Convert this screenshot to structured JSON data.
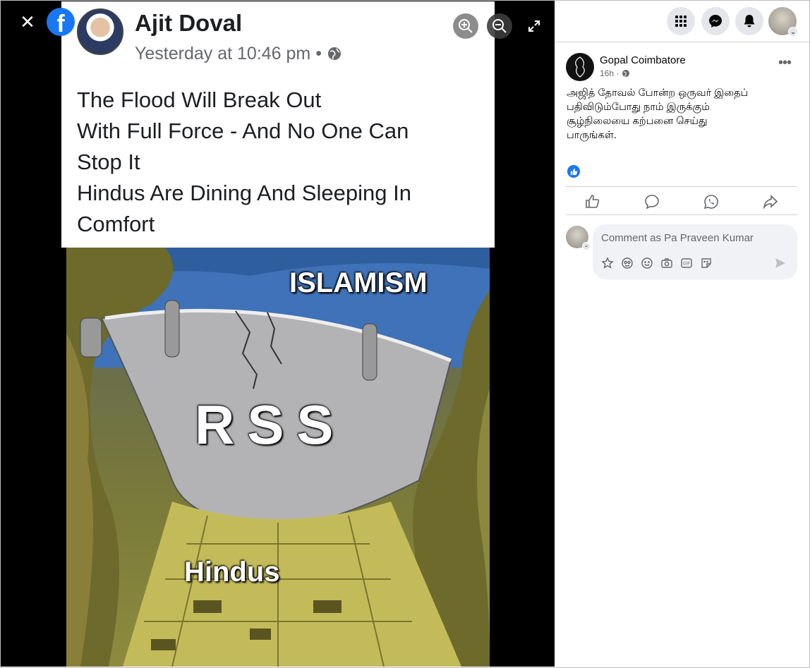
{
  "viewer": {
    "close_icon": "close-icon",
    "logo": "facebook-logo",
    "tools": [
      "zoom-in-icon",
      "zoom-out-icon",
      "fullscreen-icon"
    ]
  },
  "photo": {
    "post_card": {
      "author": "Ajit Doval",
      "timestamp": "Yesterday at 10:46 pm • ",
      "text_lines": [
        "The Flood Will Break Out",
        "With Full Force - And No One Can",
        "Stop It",
        "Hindus Are Dining And Sleeping In",
        "Comfort"
      ]
    },
    "meme": {
      "label_top": "ISLAMISM",
      "label_dam": "RSS",
      "label_bottom": "Hindus"
    }
  },
  "top_nav": {
    "icons": [
      "menu-grid-icon",
      "messenger-icon",
      "notifications-bell-icon",
      "account-avatar"
    ]
  },
  "post": {
    "author": "Gopal Coimbatore",
    "time": "16h · ",
    "caption_lines": [
      "அஜித் தோவல் போன்ற ஒருவர் இதைப்",
      "பதிவிடும்போது நாம் இருக்கும்",
      "சூழ்நிலையை கற்பனை செய்து",
      "பாருங்கள்."
    ],
    "reaction": "like",
    "actions": [
      "like-icon",
      "comment-icon",
      "whatsapp-icon",
      "share-icon"
    ]
  },
  "comment": {
    "placeholder": "Comment as Pa Praveen Kumar",
    "tools": [
      "avatar-sticker-icon",
      "emoji-face-icon",
      "smiley-icon",
      "camera-icon",
      "gif-icon",
      "sticker-icon"
    ],
    "send_icon": "send-icon"
  },
  "colors": {
    "brand": "#1877f2",
    "secondary_text": "#65676b",
    "button_bg": "#e4e6eb",
    "comment_bg": "#f0f2f5"
  }
}
